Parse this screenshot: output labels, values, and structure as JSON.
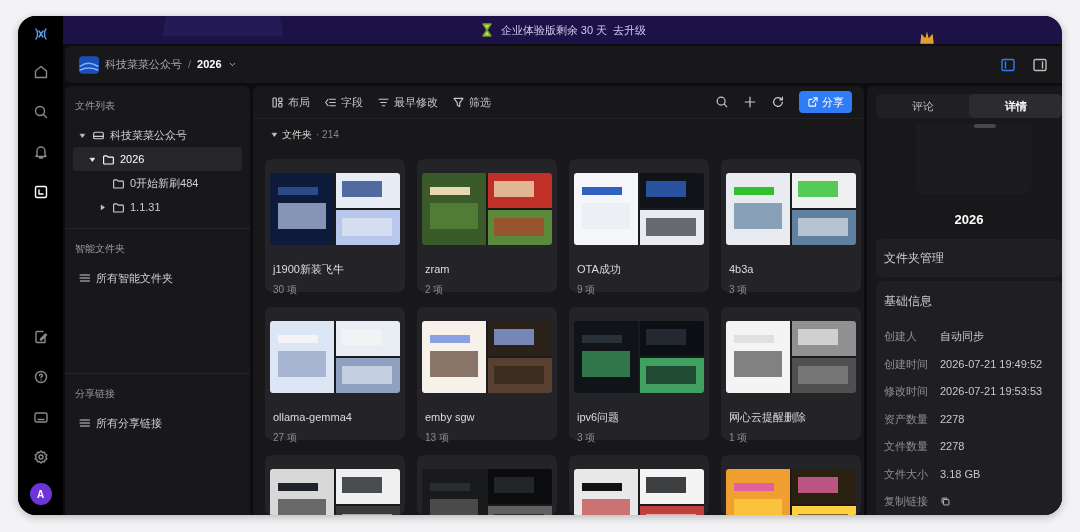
{
  "rail": {
    "items": [
      {
        "kind": "home",
        "selected": false
      },
      {
        "kind": "search",
        "selected": false
      },
      {
        "kind": "bell",
        "selected": false
      },
      {
        "kind": "library",
        "selected": true
      }
    ],
    "bottom": [
      {
        "kind": "edit"
      },
      {
        "kind": "help"
      },
      {
        "kind": "keyboard"
      },
      {
        "kind": "settings"
      }
    ],
    "avatar": "A"
  },
  "banner": {
    "text": "企业体验版剩余 30 天",
    "link": "去升级"
  },
  "breadcrumb": {
    "root": "科技菜菜公众号",
    "separator": "/",
    "current": "2026"
  },
  "view_toggles": [
    {
      "kind": "left",
      "selected": true
    },
    {
      "kind": "right",
      "selected": false
    }
  ],
  "sidebar": {
    "sections": [
      {
        "title": "文件列表",
        "tree": [
          {
            "label": "科技菜菜公众号",
            "expanded": true,
            "selected": false,
            "children": [
              {
                "label": "2026",
                "expanded": true,
                "selected": true,
                "children": [
                  {
                    "label": "0开始新刷484",
                    "selected": false
                  },
                  {
                    "label": "1.1.31",
                    "expanded": false,
                    "selected": false
                  }
                ]
              }
            ]
          }
        ]
      },
      {
        "title": "智能文件夹",
        "items": [
          "所有智能文件夹"
        ]
      },
      {
        "title": "分享链接",
        "items": [
          "所有分享链接"
        ]
      }
    ]
  },
  "toolbar": {
    "tools": [
      {
        "kind": "layout",
        "label": "布局"
      },
      {
        "kind": "fields",
        "label": "字段"
      },
      {
        "kind": "sort",
        "label": "最早修改"
      },
      {
        "kind": "filter",
        "label": "筛选"
      }
    ],
    "actions": [
      {
        "kind": "search"
      },
      {
        "kind": "add"
      },
      {
        "kind": "refresh"
      }
    ],
    "share": "分享"
  },
  "group": {
    "label": "文件夹",
    "count": "· 214",
    "expanded": true
  },
  "folders": [
    {
      "kind": "folder",
      "name": "j1900新装飞牛",
      "count": "30 项"
    },
    {
      "kind": "folder",
      "name": "zram",
      "count": "2 项"
    },
    {
      "kind": "folder",
      "name": "OTA成功",
      "count": "9 项"
    },
    {
      "kind": "folder",
      "name": "4b3a",
      "count": "3 项"
    },
    {
      "kind": "folder",
      "name": "ollama-gemma4",
      "count": "27 项"
    },
    {
      "kind": "folder",
      "name": "emby sgw",
      "count": "13 项"
    },
    {
      "kind": "folder",
      "name": "ipv6问题",
      "count": "3 项"
    },
    {
      "kind": "folder",
      "name": "网心云提醒删除",
      "count": "1 项"
    },
    {
      "kind": "partial"
    },
    {
      "kind": "partial"
    },
    {
      "kind": "partial"
    },
    {
      "kind": "partial"
    }
  ],
  "details": {
    "tabs": [
      {
        "label": "评论",
        "selected": false
      },
      {
        "label": "详情",
        "selected": true
      }
    ],
    "title": "2026",
    "manage": "文件夹管理",
    "section": "基础信息",
    "rows": [
      {
        "label": "创建人",
        "value": "自动同步"
      },
      {
        "label": "创建时间",
        "value": "2026-07-21 19:49:52"
      },
      {
        "label": "修改时间",
        "value": "2026-07-21 19:53:53"
      },
      {
        "label": "资产数量",
        "value": "2278"
      },
      {
        "label": "文件数量",
        "value": "2278"
      },
      {
        "label": "文件大小",
        "value": "3.18 GB"
      },
      {
        "label": "复制链接",
        "kind": "copy"
      }
    ]
  }
}
